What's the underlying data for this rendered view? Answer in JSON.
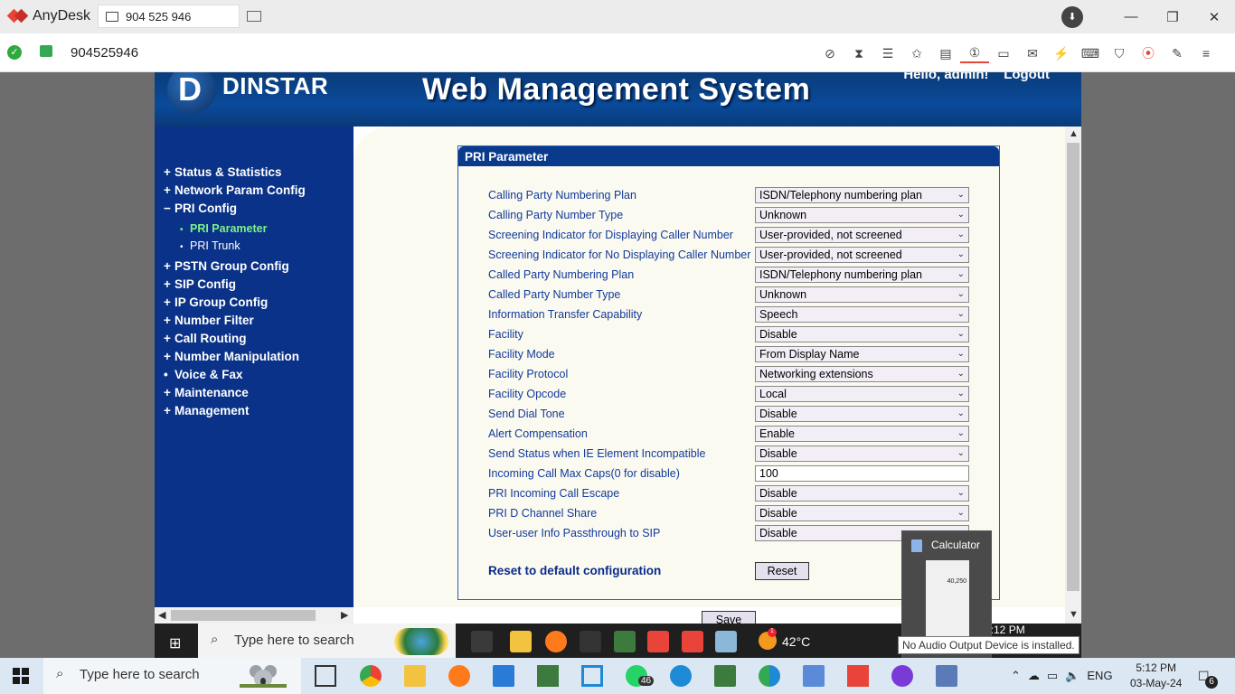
{
  "anydesk": {
    "app_name": "AnyDesk",
    "tab_label": "904 525 946",
    "address": "904525946",
    "toolbar_icons": [
      "privacy-icon",
      "hourglass-icon",
      "database-icon",
      "star-icon",
      "file-transfer-icon",
      "monitor-1-icon",
      "display-icon",
      "chat-icon",
      "action-icon",
      "keyboard-icon",
      "shield-icon",
      "record-icon",
      "draw-icon",
      "menu-icon"
    ],
    "accent": "#e8443a"
  },
  "web": {
    "logo": "DINSTAR",
    "title": "Web Management System",
    "greeting": "Hello, admin!",
    "logout": "Logout",
    "nav": [
      {
        "sign": "+",
        "label": "Status & Statistics"
      },
      {
        "sign": "+",
        "label": "Network Param Config"
      },
      {
        "sign": "−",
        "label": "PRI Config"
      },
      {
        "sign": "+",
        "label": "PSTN Group Config"
      },
      {
        "sign": "+",
        "label": "SIP Config"
      },
      {
        "sign": "+",
        "label": "IP Group Config"
      },
      {
        "sign": "+",
        "label": "Number Filter"
      },
      {
        "sign": "+",
        "label": "Call Routing"
      },
      {
        "sign": "+",
        "label": "Number Manipulation"
      },
      {
        "sign": "•",
        "label": "Voice & Fax"
      },
      {
        "sign": "+",
        "label": "Maintenance"
      },
      {
        "sign": "+",
        "label": "Management"
      }
    ],
    "subnav": [
      {
        "label": "PRI Parameter",
        "selected": true
      },
      {
        "label": "PRI Trunk",
        "selected": false
      }
    ],
    "panel_title": "PRI Parameter",
    "fields": [
      {
        "label": "Calling Party Numbering Plan",
        "value": "ISDN/Telephony numbering plan",
        "kind": "select"
      },
      {
        "label": "Calling Party Number Type",
        "value": "Unknown",
        "kind": "select"
      },
      {
        "label": "Screening Indicator for Displaying Caller Number",
        "value": "User-provided, not screened",
        "kind": "select"
      },
      {
        "label": "Screening Indicator for No Displaying Caller Number",
        "value": "User-provided, not screened",
        "kind": "select"
      },
      {
        "label": "Called Party Numbering Plan",
        "value": "ISDN/Telephony numbering plan",
        "kind": "select"
      },
      {
        "label": "Called Party Number Type",
        "value": "Unknown",
        "kind": "select"
      },
      {
        "label": "Information Transfer Capability",
        "value": "Speech",
        "kind": "select"
      },
      {
        "label": "Facility",
        "value": "Disable",
        "kind": "select"
      },
      {
        "label": "Facility Mode",
        "value": "From Display Name",
        "kind": "select"
      },
      {
        "label": "Facility Protocol",
        "value": "Networking extensions",
        "kind": "select"
      },
      {
        "label": "Facility Opcode",
        "value": "Local",
        "kind": "select"
      },
      {
        "label": "Send Dial Tone",
        "value": "Disable",
        "kind": "select"
      },
      {
        "label": "Alert Compensation",
        "value": "Enable",
        "kind": "select"
      },
      {
        "label": "Send Status when IE Element Incompatible",
        "value": "Disable",
        "kind": "select"
      },
      {
        "label": "Incoming Call Max Caps(0 for disable)",
        "value": "100",
        "kind": "input"
      },
      {
        "label": "PRI Incoming Call Escape",
        "value": "Disable",
        "kind": "select"
      },
      {
        "label": "PRI D Channel Share",
        "value": "Disable",
        "kind": "select"
      },
      {
        "label": "User-user Info Passthrough to SIP",
        "value": "Disable",
        "kind": "select"
      }
    ],
    "reset_label": "Reset to default configuration",
    "reset_button": "Reset",
    "save_button": "Save"
  },
  "remote_taskbar": {
    "search_placeholder": "Type here to search",
    "temperature": "42°C",
    "time": "5:12 PM",
    "badge_count": "1"
  },
  "calculator_preview": {
    "title": "Calculator",
    "display": "40,250"
  },
  "tooltip": "No Audio Output Device is installed.",
  "taskbar": {
    "search_placeholder": "Type here to search",
    "whatsapp_badge": "46",
    "lang": "ENG",
    "time": "5:12 PM",
    "date": "03-May-24",
    "notifications": "6"
  }
}
